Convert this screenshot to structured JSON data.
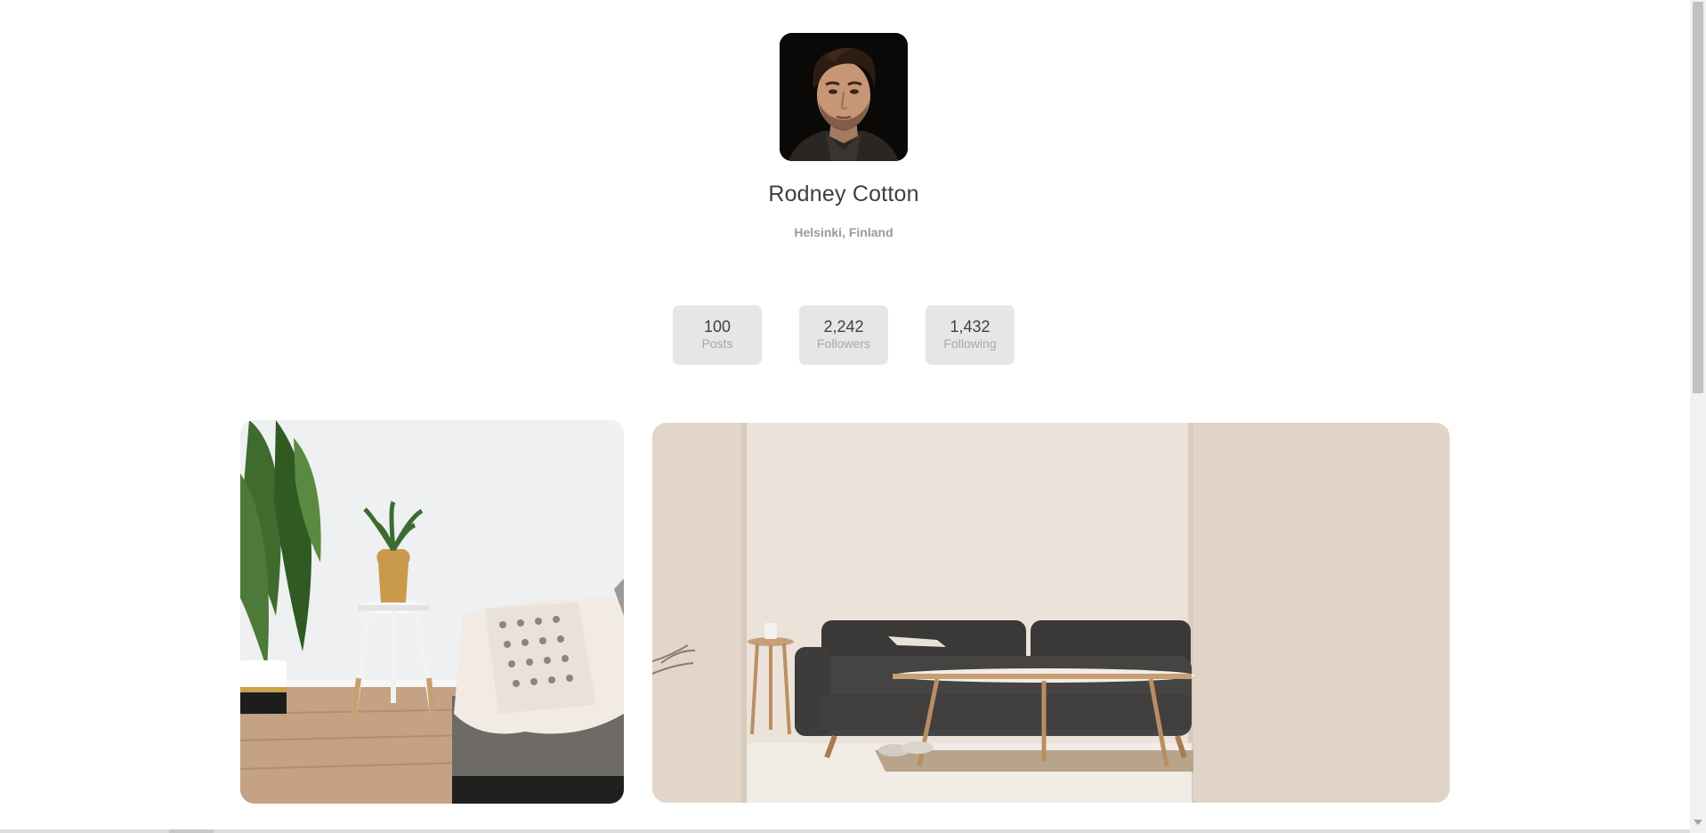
{
  "profile": {
    "name": "Rodney Cotton",
    "location": "Helsinki, Finland"
  },
  "stats": [
    {
      "value": "100",
      "label": "Posts"
    },
    {
      "value": "2,242",
      "label": "Followers"
    },
    {
      "value": "1,432",
      "label": "Following"
    }
  ],
  "colors": {
    "text_primary": "#3f3f3f",
    "text_muted": "#9a9a9a",
    "stat_bg": "#e6e6e6"
  }
}
